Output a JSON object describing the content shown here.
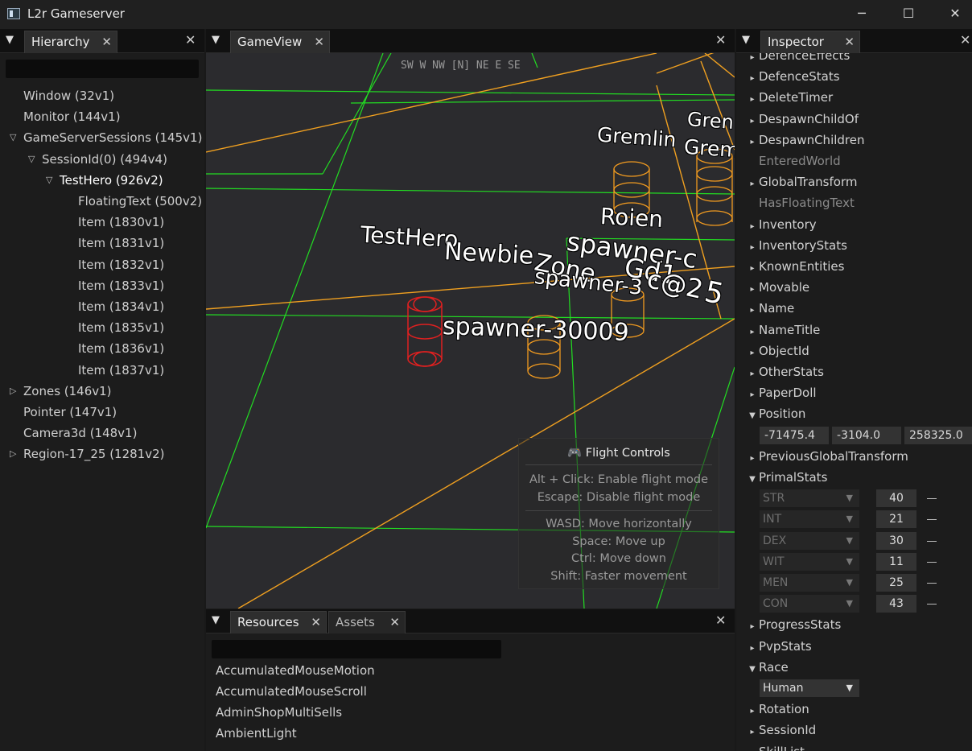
{
  "window": {
    "title": "L2r Gameserver",
    "minimize": "─",
    "maximize": "☐",
    "close": "✕"
  },
  "hierarchy": {
    "tab_label": "Hierarchy",
    "search_placeholder": "",
    "items": [
      {
        "label": "Window (32v1)",
        "expander": "",
        "indent": 0
      },
      {
        "label": "Monitor (144v1)",
        "expander": "",
        "indent": 0
      },
      {
        "label": "GameServerSessions (145v1)",
        "expander": "▽",
        "indent": 0
      },
      {
        "label": "SessionId(0) (494v4)",
        "expander": "▽",
        "indent": 1
      },
      {
        "label": "TestHero (926v2)",
        "expander": "▽",
        "indent": 2,
        "selected": true
      },
      {
        "label": "FloatingText (500v2)",
        "expander": "",
        "indent": 3
      },
      {
        "label": "Item (1830v1)",
        "expander": "",
        "indent": 3
      },
      {
        "label": "Item (1831v1)",
        "expander": "",
        "indent": 3
      },
      {
        "label": "Item (1832v1)",
        "expander": "",
        "indent": 3
      },
      {
        "label": "Item (1833v1)",
        "expander": "",
        "indent": 3
      },
      {
        "label": "Item (1834v1)",
        "expander": "",
        "indent": 3
      },
      {
        "label": "Item (1835v1)",
        "expander": "",
        "indent": 3
      },
      {
        "label": "Item (1836v1)",
        "expander": "",
        "indent": 3
      },
      {
        "label": "Item (1837v1)",
        "expander": "",
        "indent": 3
      },
      {
        "label": "Zones (146v1)",
        "expander": "▷",
        "indent": 0
      },
      {
        "label": "Pointer (147v1)",
        "expander": "",
        "indent": 0
      },
      {
        "label": "Camera3d (148v1)",
        "expander": "",
        "indent": 0
      },
      {
        "label": "Region-17_25 (1281v2)",
        "expander": "▷",
        "indent": 0
      }
    ]
  },
  "gameview": {
    "tab_label": "GameView",
    "compass": "SW  W  NW [N] NE  E  SE",
    "labels": {
      "gremlin1": "Gremlin",
      "gremlin2": "Grem",
      "gremlin3": "Gren",
      "roien": "Roien",
      "testhero": "TestHero",
      "newbie": "Newbie",
      "zone": "Zone",
      "spawner_a": "spawner-c",
      "spawner_b": "spawner-3",
      "spawner_30009": "spawner-30009",
      "garble1": "Gd1",
      "garble2": "c@2",
      "garble3": "5"
    },
    "flight_controls": {
      "title": "🎮 Flight Controls",
      "lines": [
        "Alt + Click: Enable flight mode",
        "Escape: Disable flight mode"
      ],
      "lines2": [
        "WASD: Move horizontally",
        "Space: Move up",
        "Ctrl: Move down",
        "Shift: Faster movement"
      ]
    }
  },
  "inspector": {
    "tab_label": "Inspector",
    "items_top": [
      {
        "label": "DefenceEffects",
        "dim": false
      },
      {
        "label": "DefenceStats",
        "dim": false
      },
      {
        "label": "DeleteTimer",
        "dim": false
      },
      {
        "label": "DespawnChildOf",
        "dim": false
      },
      {
        "label": "DespawnChildren",
        "dim": false
      },
      {
        "label": "EnteredWorld",
        "dim": true
      },
      {
        "label": "GlobalTransform",
        "dim": false
      },
      {
        "label": "HasFloatingText",
        "dim": true
      },
      {
        "label": "Inventory",
        "dim": false
      },
      {
        "label": "InventoryStats",
        "dim": false
      },
      {
        "label": "KnownEntities",
        "dim": false
      },
      {
        "label": "Movable",
        "dim": false
      },
      {
        "label": "Name",
        "dim": false
      },
      {
        "label": "NameTitle",
        "dim": false
      },
      {
        "label": "ObjectId",
        "dim": false
      },
      {
        "label": "OtherStats",
        "dim": false
      },
      {
        "label": "PaperDoll",
        "dim": false
      }
    ],
    "position": {
      "label": "Position",
      "x": "-71475.4",
      "y": "-3104.0",
      "z": "258325.0"
    },
    "previous_transform": "PreviousGlobalTransform",
    "primal_stats": {
      "label": "PrimalStats",
      "stats": [
        {
          "name": "STR",
          "value": "40"
        },
        {
          "name": "INT",
          "value": "21"
        },
        {
          "name": "DEX",
          "value": "30"
        },
        {
          "name": "WIT",
          "value": "11"
        },
        {
          "name": "MEN",
          "value": "25"
        },
        {
          "name": "CON",
          "value": "43"
        }
      ]
    },
    "items_mid": [
      "ProgressStats",
      "PvpStats"
    ],
    "race": {
      "label": "Race",
      "value": "Human"
    },
    "items_bottom": [
      "Rotation",
      "SessionId",
      "SkillList"
    ]
  },
  "resources": {
    "tab_label": "Resources",
    "assets_tab_label": "Assets",
    "search_placeholder": "",
    "items": [
      "AccumulatedMouseMotion",
      "AccumulatedMouseScroll",
      "AdminShopMultiSells",
      "AmbientLight"
    ]
  },
  "colors": {
    "grid": "#22dd22",
    "zone_lines": "#f0a020",
    "enemy": "#f09a20",
    "hero": "#e02020"
  }
}
